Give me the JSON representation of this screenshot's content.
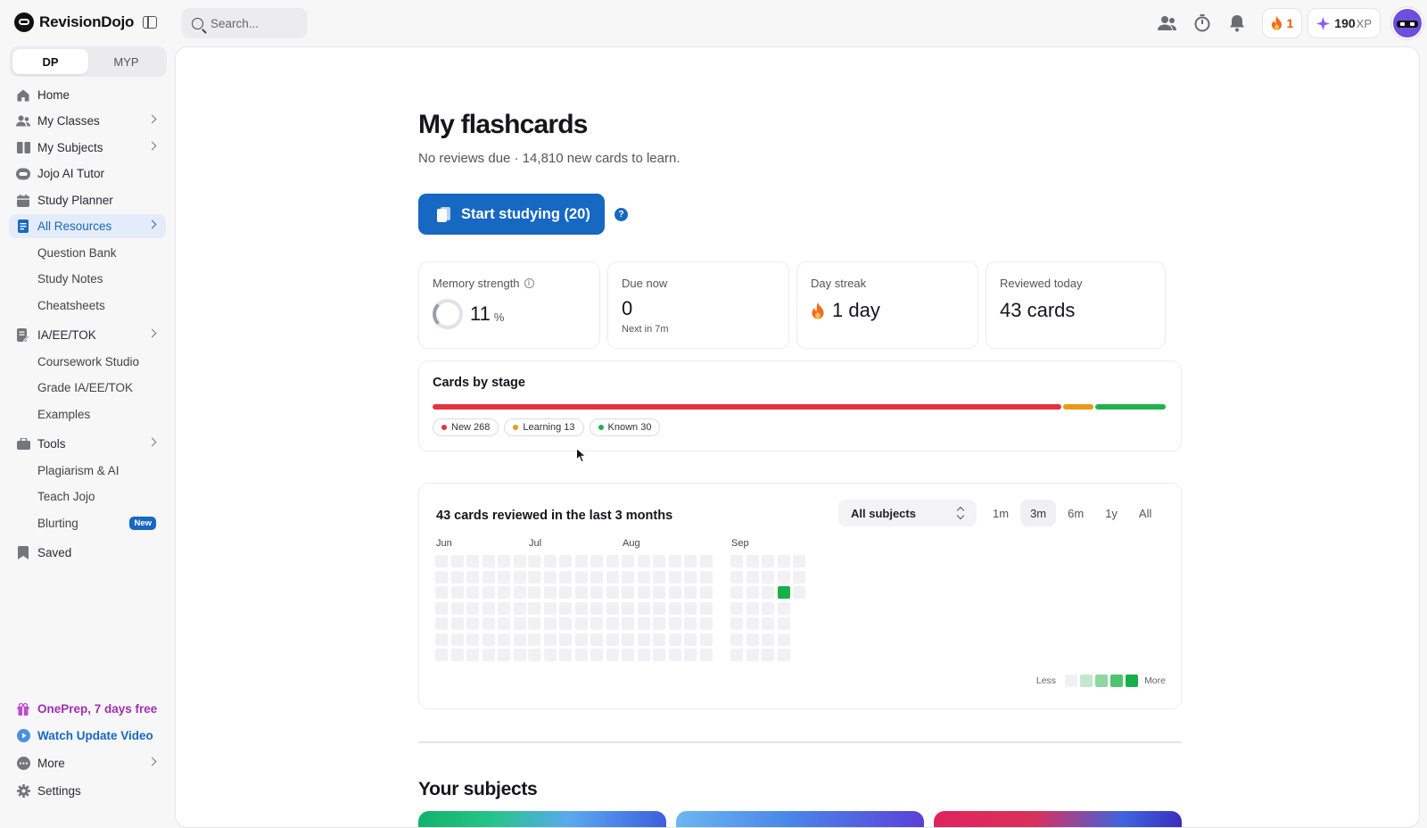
{
  "app": {
    "name": "RevisionDojo",
    "search_placeholder": "Search...",
    "streak_count": "1",
    "xp_value": "190",
    "xp_unit": "XP",
    "accent_color": "#1668c2"
  },
  "sidebar": {
    "level_tabs": [
      {
        "label": "DP",
        "active": true
      },
      {
        "label": "MYP",
        "active": false
      }
    ],
    "items": [
      {
        "label": "Home",
        "icon": "home-icon"
      },
      {
        "label": "My Classes",
        "icon": "users-icon",
        "chevron": true
      },
      {
        "label": "My Subjects",
        "icon": "book-icon",
        "chevron": true
      },
      {
        "label": "Jojo AI Tutor",
        "icon": "robot-icon"
      },
      {
        "label": "Study Planner",
        "icon": "calendar-icon"
      },
      {
        "label": "All Resources",
        "icon": "file-icon",
        "chevron": true,
        "active": true
      },
      {
        "label": "Question Bank",
        "sub": true
      },
      {
        "label": "Study Notes",
        "sub": true
      },
      {
        "label": "Cheatsheets",
        "sub": true
      },
      {
        "label": "IA/EE/TOK",
        "icon": "document-edit-icon",
        "chevron": true
      },
      {
        "label": "Coursework Studio",
        "sub": true
      },
      {
        "label": "Grade IA/EE/TOK",
        "sub": true
      },
      {
        "label": "Examples",
        "sub": true
      },
      {
        "label": "Tools",
        "icon": "toolbox-icon",
        "chevron": true
      },
      {
        "label": "Plagiarism & AI",
        "sub": true
      },
      {
        "label": "Teach Jojo",
        "sub": true
      },
      {
        "label": "Blurting",
        "sub": true,
        "badge": "New"
      },
      {
        "label": "Saved",
        "icon": "bookmark-icon"
      }
    ],
    "bottom": [
      {
        "label": "OnePrep, 7 days free",
        "icon": "gift-icon"
      },
      {
        "label": "Watch Update Video",
        "icon": "play-icon"
      },
      {
        "label": "More",
        "icon": "more-icon",
        "chevron": true
      },
      {
        "label": "Settings",
        "icon": "gear-icon"
      }
    ]
  },
  "main": {
    "title": "My flashcards",
    "subtitle": "No reviews due · 14,810 new cards to learn.",
    "start_button": "Start studying (20)",
    "help": "?",
    "stats": {
      "memory": {
        "label": "Memory strength",
        "value": "11",
        "unit": "%"
      },
      "due": {
        "label": "Due now",
        "value": "0",
        "sub": "Next in 7m"
      },
      "streak": {
        "label": "Day streak",
        "value": "1 day"
      },
      "reviewed": {
        "label": "Reviewed today",
        "value": "43 cards"
      }
    },
    "stages": {
      "title": "Cards by stage",
      "items": [
        {
          "label": "New 268",
          "count": 268,
          "color": "#e5323f"
        },
        {
          "label": "Learning 13",
          "count": 13,
          "color": "#e89a1a"
        },
        {
          "label": "Known 30",
          "count": 30,
          "color": "#22b24c"
        }
      ]
    },
    "activity": {
      "title": "43 cards reviewed in the last 3 months",
      "subject_select": "All subjects",
      "ranges": [
        {
          "label": "1m",
          "active": false
        },
        {
          "label": "3m",
          "active": true
        },
        {
          "label": "6m",
          "active": false
        },
        {
          "label": "1y",
          "active": false
        },
        {
          "label": "All",
          "active": false
        }
      ],
      "months": [
        "Jun",
        "Jul",
        "Aug",
        "Sep"
      ],
      "legend_less": "Less",
      "legend_more": "More",
      "scale_colors": [
        "#f1f1f3",
        "#c4e8cd",
        "#8fd6a2",
        "#4fc46f",
        "#16b04a"
      ]
    },
    "subjects_heading": "Your subjects"
  }
}
